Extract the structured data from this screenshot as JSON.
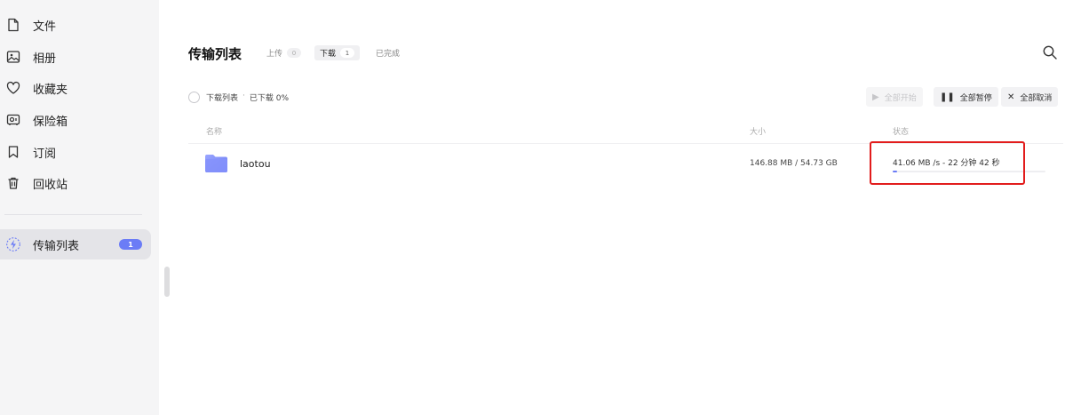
{
  "sidebar": {
    "items": [
      {
        "label": "文件",
        "icon": "file-icon"
      },
      {
        "label": "相册",
        "icon": "photo-icon"
      },
      {
        "label": "收藏夹",
        "icon": "heart-icon"
      },
      {
        "label": "保险箱",
        "icon": "safe-icon"
      },
      {
        "label": "订阅",
        "icon": "bookmark-icon"
      },
      {
        "label": "回收站",
        "icon": "trash-icon"
      }
    ],
    "transfer": {
      "label": "传输列表",
      "icon": "lightning-icon",
      "badge": "1"
    }
  },
  "header": {
    "title": "传输列表",
    "tabs": [
      {
        "label": "上传",
        "count": "0"
      },
      {
        "label": "下载",
        "count": "1"
      },
      {
        "label": "已完成"
      }
    ],
    "active_tab": "下载"
  },
  "summary": {
    "list_label": "下载列表",
    "separator": "·",
    "progress_text": "已下载 0%"
  },
  "actions": {
    "start_all": "全部开始",
    "pause_all": "全部暂停",
    "cancel_all": "全部取消"
  },
  "table": {
    "columns": {
      "name": "名称",
      "size": "大小",
      "status": "状态"
    },
    "rows": [
      {
        "name": "laotou",
        "size": "146.88 MB / 54.73 GB",
        "status": "41.06 MB /s - 22 分钟 42 秒",
        "progress": 0.027
      }
    ]
  },
  "colors": {
    "accent": "#6b7cf6",
    "highlight": "#e21c1c"
  }
}
